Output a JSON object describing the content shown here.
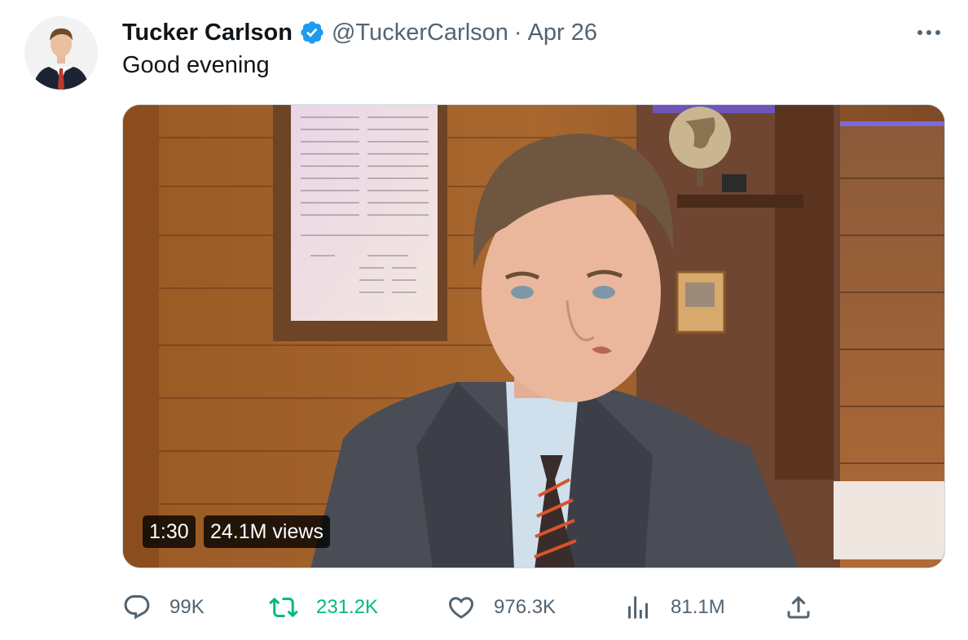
{
  "tweet": {
    "author_name": "Tucker Carlson",
    "handle": "@TuckerCarlson",
    "separator": "·",
    "date": "Apr 26",
    "text": "Good evening",
    "verified_icon": "verified-badge-icon",
    "more_icon": "more-options-icon"
  },
  "video": {
    "duration": "1:30",
    "views": "24.1M views"
  },
  "actions": {
    "reply_count": "99K",
    "retweet_count": "231.2K",
    "like_count": "976.3K",
    "views_count": "81.1M"
  },
  "colors": {
    "verified": "#1d9bf0",
    "retweet_active": "#00ba7c",
    "secondary_text": "#536471"
  }
}
